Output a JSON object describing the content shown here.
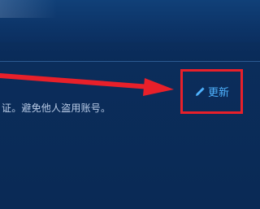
{
  "row": {
    "description": "证。避免他人盗用账号。"
  },
  "actions": {
    "update_label": "更新",
    "update_icon": "pencil-icon"
  },
  "annotation": {
    "arrow_color": "#e8202a",
    "box_color": "#e8202a"
  }
}
